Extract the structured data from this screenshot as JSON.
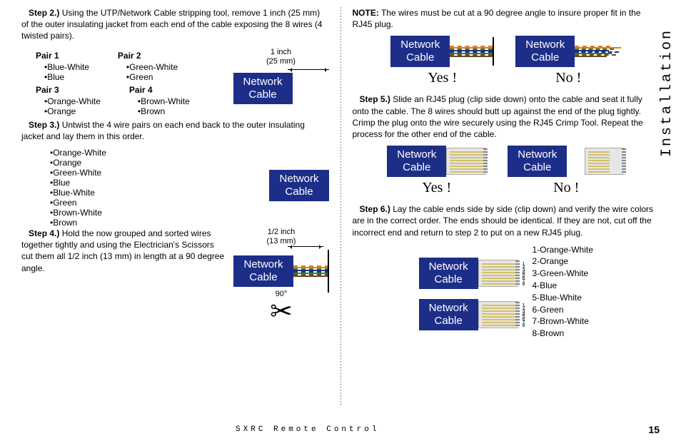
{
  "side_label": "Installation",
  "footer_title": "SXRC Remote Control",
  "page_number": "15",
  "cable_label1": "Network",
  "cable_label2": "Cable",
  "yes_label": "Yes !",
  "no_label": "No !",
  "one_inch_1": "1 inch",
  "one_inch_2": "(25 mm)",
  "half_inch_1": "1/2 inch",
  "half_inch_2": "(13 mm)",
  "angle_90": "90°",
  "step2": {
    "heading": "Step 2.)",
    "text": " Using the UTP/Network Cable stripping tool, remove 1 inch (25 mm) of the outer insulating jacket from each end of the cable exposing the 8 wires (4 twisted pairs)."
  },
  "pairs": {
    "p1": {
      "title": "Pair 1",
      "a": "Blue-White",
      "b": "Blue"
    },
    "p2": {
      "title": "Pair 2",
      "a": "Green-White",
      "b": "Green"
    },
    "p3": {
      "title": "Pair 3",
      "a": "Orange-White",
      "b": "Orange"
    },
    "p4": {
      "title": "Pair 4",
      "a": "Brown-White",
      "b": "Brown"
    }
  },
  "step3": {
    "heading": "Step 3.)",
    "text": " Untwist the 4 wire pairs on each end back to the outer insulating jacket and lay them in this order."
  },
  "order": {
    "w1": "Orange-White",
    "w2": "Orange",
    "w3": "Green-White",
    "w4": "Blue",
    "w5": "Blue-White",
    "w6": "Green",
    "w7": "Brown-White",
    "w8": "Brown"
  },
  "step4": {
    "heading": "Step 4.)",
    "text": " Hold the now grouped and sorted wires together tightly and using the Electrician's Scissors cut them all 1/2 inch (13 mm) in length at a 90 degree angle."
  },
  "note_label": "NOTE:",
  "note_text": " The wires must be cut at a 90 degree angle to insure proper fit in the RJ45 plug.",
  "step5": {
    "heading": "Step 5.)",
    "text": " Slide an RJ45 plug (clip side down) onto the cable and seat it fully onto the cable. The 8 wires should butt up against the end of the plug tightly. Crimp the plug onto the wire securely using the RJ45 Crimp Tool. Repeat the process for the other end of the cable."
  },
  "step6": {
    "heading": "Step 6.)",
    "text": " Lay the cable ends side by side (clip down) and verify the wire colors are in the correct order. The ends should be identical. If they are not, cut off the incorrect end and return to step 2 to put on a new RJ45 plug."
  },
  "pinout": {
    "l1": "1-Orange-White",
    "l2": "2-Orange",
    "l3": "3-Green-White",
    "l4": "4-Blue",
    "l5": "5-Blue-White",
    "l6": "6-Green",
    "l7": "7-Brown-White",
    "l8": "8-Brown"
  }
}
